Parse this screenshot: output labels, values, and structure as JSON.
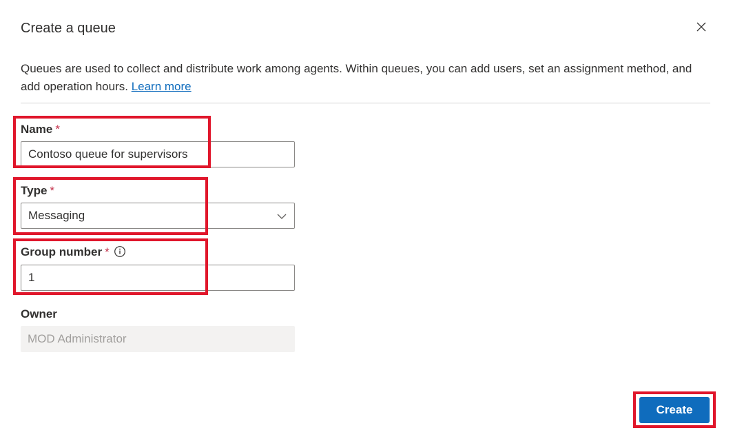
{
  "dialog": {
    "title": "Create a queue",
    "description": "Queues are used to collect and distribute work among agents. Within queues, you can add users, set an assignment method, and add operation hours.",
    "learn_more": "Learn more"
  },
  "form": {
    "name": {
      "label": "Name",
      "required_mark": "*",
      "value": "Contoso queue for supervisors"
    },
    "type": {
      "label": "Type",
      "required_mark": "*",
      "value": "Messaging"
    },
    "group_number": {
      "label": "Group number",
      "required_mark": "*",
      "value": "1"
    },
    "owner": {
      "label": "Owner",
      "value": "MOD Administrator"
    }
  },
  "actions": {
    "create_label": "Create"
  },
  "colors": {
    "accent": "#0f6cbd",
    "highlight": "#e0162b",
    "required": "#c4314b"
  },
  "icons": {
    "close": "close-icon",
    "dropdown": "chevron-down-icon",
    "info": "info-icon"
  }
}
